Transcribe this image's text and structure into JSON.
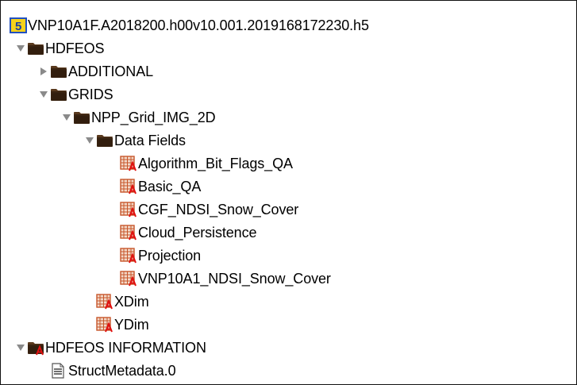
{
  "colors": {
    "folder_dark": "#3a2412",
    "folder_light": "#c9b79a",
    "dataset_orange": "#c7562a",
    "dataset_grid": "#f3d9c9",
    "attribute_red": "#e01010",
    "disclosure": "#8a8a8a"
  },
  "tree": {
    "root": {
      "label": "VNP10A1F.A2018200.h00v10.001.2019168172230.h5",
      "icon": "hdf5-file-icon"
    },
    "hdfeos": {
      "label": "HDFEOS",
      "icon": "folder-icon",
      "expanded": true
    },
    "additional": {
      "label": "ADDITIONAL",
      "icon": "folder-icon",
      "expanded": false
    },
    "grids": {
      "label": "GRIDS",
      "icon": "folder-icon",
      "expanded": true
    },
    "npp_grid": {
      "label": "NPP_Grid_IMG_2D",
      "icon": "folder-icon",
      "expanded": true
    },
    "data_fields": {
      "label": "Data Fields",
      "icon": "folder-icon",
      "expanded": true
    },
    "datasets": [
      {
        "label": "Algorithm_Bit_Flags_QA",
        "icon": "dataset-icon"
      },
      {
        "label": "Basic_QA",
        "icon": "dataset-icon"
      },
      {
        "label": "CGF_NDSI_Snow_Cover",
        "icon": "dataset-icon"
      },
      {
        "label": "Cloud_Persistence",
        "icon": "dataset-icon"
      },
      {
        "label": "Projection",
        "icon": "dataset-icon"
      },
      {
        "label": "VNP10A1_NDSI_Snow_Cover",
        "icon": "dataset-icon"
      }
    ],
    "xdim": {
      "label": "XDim",
      "icon": "dataset-icon"
    },
    "ydim": {
      "label": "YDim",
      "icon": "dataset-icon"
    },
    "hdfeos_information": {
      "label": "HDFEOS INFORMATION",
      "icon": "folder-attribute-icon",
      "expanded": true
    },
    "struct_metadata": {
      "label": "StructMetadata.0",
      "icon": "text-document-icon"
    }
  }
}
